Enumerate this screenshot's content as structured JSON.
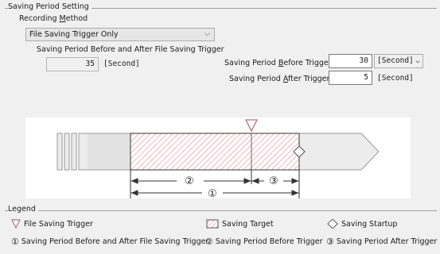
{
  "group": {
    "title": "Saving Period Setting"
  },
  "recording_method": {
    "label": "Recording Method",
    "label_prefix": "Recording ",
    "label_mnemonic": "M",
    "label_suffix": "ethod",
    "selected": "File Saving Trigger Only"
  },
  "before_after": {
    "label": "Saving Period Before and After File Saving Trigger",
    "value": "35",
    "unit": "[Second]"
  },
  "before_trigger": {
    "label": "Saving Period Before Trigger",
    "label_prefix": "Saving Period ",
    "label_mnemonic": "B",
    "label_suffix": "efore Trigger",
    "value": "30",
    "unit": "[Second]"
  },
  "after_trigger": {
    "label": "Saving Period After Trigger",
    "label_prefix": "Saving Period ",
    "label_mnemonic": "A",
    "label_suffix": "fter Trigger",
    "value": "5",
    "unit": "[Second]"
  },
  "diagram": {
    "marker_1": "①",
    "marker_2": "②",
    "marker_3": "③",
    "colors": {
      "trigger": "#b07080",
      "target_stroke": "#d04b4b",
      "arrow": "#333333"
    }
  },
  "legend": {
    "title": "Legend",
    "file_saving_trigger": "File Saving Trigger",
    "saving_target": "Saving Target",
    "saving_startup": "Saving Startup",
    "item1_marker": "①",
    "item1_label": "Saving Period Before and After File Saving Trigger",
    "item2_marker": "②",
    "item2_label": "Saving Period Before Trigger",
    "item3_marker": "③",
    "item3_label": "Saving Period After Trigger"
  }
}
